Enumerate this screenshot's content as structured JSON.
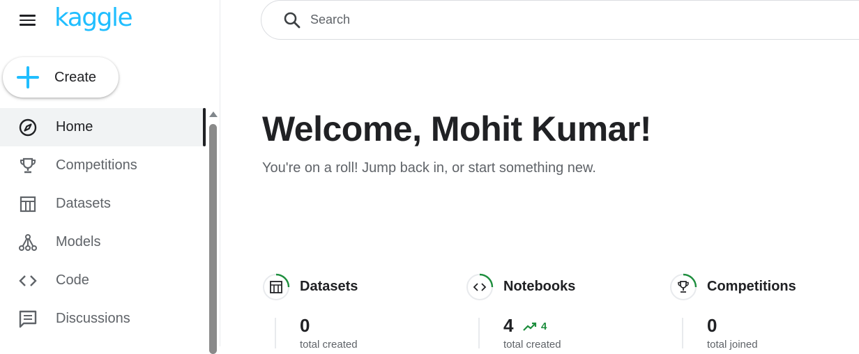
{
  "brand": {
    "logo_text": "kaggle",
    "color": "#20beff"
  },
  "sidebar": {
    "create_label": "Create",
    "items": [
      {
        "label": "Home",
        "icon": "compass-icon",
        "active": true
      },
      {
        "label": "Competitions",
        "icon": "trophy-icon",
        "active": false
      },
      {
        "label": "Datasets",
        "icon": "table-icon",
        "active": false
      },
      {
        "label": "Models",
        "icon": "models-icon",
        "active": false
      },
      {
        "label": "Code",
        "icon": "code-icon",
        "active": false
      },
      {
        "label": "Discussions",
        "icon": "discussion-icon",
        "active": false
      }
    ]
  },
  "search": {
    "placeholder": "Search"
  },
  "main": {
    "heading": "Welcome, Mohit Kumar!",
    "subtitle": "You're on a roll! Jump back in, or start something new."
  },
  "stats": [
    {
      "title": "Datasets",
      "icon": "table-icon",
      "value": "0",
      "trend": "",
      "caption": "total created"
    },
    {
      "title": "Notebooks",
      "icon": "code-icon",
      "value": "4",
      "trend": "4",
      "caption": "total created"
    },
    {
      "title": "Competitions",
      "icon": "trophy-icon",
      "value": "0",
      "trend": "",
      "caption": "total joined"
    }
  ],
  "colors": {
    "accent": "#20beff",
    "trend_green": "#1e8e3e",
    "ring_green": "#1e8e3e"
  }
}
